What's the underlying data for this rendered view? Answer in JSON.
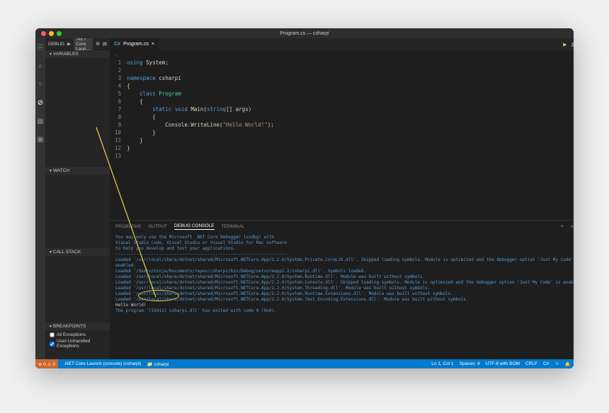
{
  "window": {
    "title": "Program.cs — csharpi"
  },
  "activitybar": {
    "items": [
      {
        "name": "explorer",
        "glyph": "⎘"
      },
      {
        "name": "search",
        "glyph": "⌕"
      },
      {
        "name": "scm",
        "glyph": "⑂"
      },
      {
        "name": "debug",
        "glyph": "⊘",
        "active": true
      },
      {
        "name": "extensions",
        "glyph": "▦"
      },
      {
        "name": "terminal",
        "glyph": "▣"
      }
    ]
  },
  "debug": {
    "label": "DEBUG",
    "play": "▶",
    "config": ".NET Core Laun…",
    "gear": "⚙",
    "sections": {
      "variables": "VARIABLES",
      "watch": "WATCH",
      "callstack": "CALL STACK",
      "breakpoints": "BREAKPOINTS"
    },
    "breakpoints": [
      {
        "label": "All Exceptions",
        "checked": false
      },
      {
        "label": "User-Unhandled Exceptions",
        "checked": true
      }
    ]
  },
  "tab": {
    "icon": "C#",
    "name": "Program.cs",
    "dirty": "×"
  },
  "tabactions": {
    "split": "▥",
    "more": "⋯"
  },
  "breadcrumb": "…",
  "code": {
    "lines": [
      {
        "n": 1,
        "t": "using",
        "r": " System;"
      },
      {
        "n": 2,
        "blank": true
      },
      {
        "n": 3,
        "t": "namespace",
        "r": " csharpi"
      },
      {
        "n": 4,
        "brace": "{"
      },
      {
        "n": 5,
        "indent": "    ",
        "t": "class",
        "cls": " Program"
      },
      {
        "n": 6,
        "indent": "    ",
        "brace": "{"
      },
      {
        "n": 7,
        "indent": "        ",
        "kw1": "static ",
        "kw2": "void ",
        "fn": "Main",
        "sig": "(",
        "kw3": "string",
        "sig2": "[] args)"
      },
      {
        "n": 8,
        "indent": "        ",
        "brace": "{"
      },
      {
        "n": 9,
        "indent": "            ",
        "obj": "Console.",
        "fn": "WriteLine",
        "open": "(",
        "str": "\"Hello World!\"",
        "close": ");"
      },
      {
        "n": 10,
        "indent": "        ",
        "brace": "}"
      },
      {
        "n": 11,
        "indent": "    ",
        "brace": "}"
      },
      {
        "n": 12,
        "brace": "}"
      },
      {
        "n": 13,
        "blank": true
      }
    ]
  },
  "panel": {
    "tabs": {
      "problems": "PROBLEMS",
      "output": "OUTPUT",
      "debugconsole": "DEBUG CONSOLE",
      "terminal": "TERMINAL"
    },
    "actions": {
      "settings": "≡",
      "up": "∧",
      "close": "×"
    },
    "lines": [
      "You may only use the Microsoft .NET Core Debugger (vsdbg) with",
      "Visual Studio Code, Visual Studio or Visual Studio for Mac software",
      "to help you develop and test your applications.",
      "-------------------------------------------------------------------",
      "Loaded '/usr/local/share/dotnet/shared/Microsoft.NETCore.App/2.2.0/System.Private.CoreLib.dll'. Skipped loading symbols. Module is optimized and the debugger option 'Just My Code' is",
      "enabled.",
      "Loaded '/Users/ninja/Documents/repos/csharpi/bin/Debug/netcoreapp2.2/csharpi.dll'. Symbols loaded.",
      "Loaded '/usr/local/share/dotnet/shared/Microsoft.NETCore.App/2.2.0/System.Runtime.dll'. Module was built without symbols.",
      "Loaded '/usr/local/share/dotnet/shared/Microsoft.NETCore.App/2.2.0/System.Console.dll'. Skipped loading symbols. Module is optimized and the debugger option 'Just My Code' is enabled.",
      "Loaded '/usr/local/share/dotnet/shared/Microsoft.NETCore.App/2.2.0/System.Threading.dll'. Module was built without symbols.",
      "Loaded '/usr/local/share/dotnet/shared/Microsoft.NETCore.App/2.2.0/System.Runtime.Extensions.dll'. Module was built without symbols.",
      "Loaded '/usr/local/share/dotnet/shared/Microsoft.NETCore.App/2.2.0/System.Text.Encoding.Extensions.dll'. Module was built without symbols."
    ],
    "output": "Hello World!",
    "exit": "The program '[33411] csharpi.dll' has exited with code 0 (0x0)."
  },
  "status": {
    "errors": "⊘ 0",
    "warnings": "⚠ 0",
    "launch": ".NET Core Launch (console) (csharpi)",
    "folder": "📁 csharpi",
    "pos": "Ln 1, Col 1",
    "spaces": "Spaces: 4",
    "enc": "UTF-8 with BOM",
    "eol": "CRLF",
    "lang": "C#",
    "feedback": "☺",
    "bell": "🔔"
  }
}
